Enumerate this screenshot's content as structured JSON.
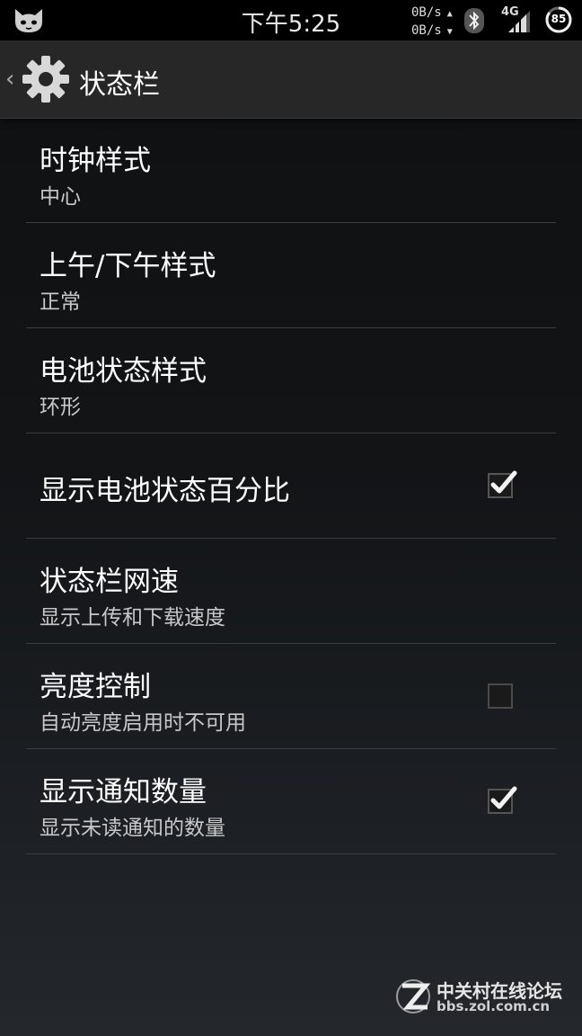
{
  "status_bar": {
    "time": "下午5:25",
    "net_up": "0B/s",
    "net_down": "0B/s",
    "network_type": "4G",
    "battery_level": "85"
  },
  "action_bar": {
    "title": "状态栏",
    "back_glyph": "‹"
  },
  "settings": [
    {
      "title": "时钟样式",
      "summary": "中心"
    },
    {
      "title": "上午/下午样式",
      "summary": "正常"
    },
    {
      "title": "电池状态样式",
      "summary": "环形"
    },
    {
      "title": "显示电池状态百分比",
      "checked": true
    },
    {
      "title": "状态栏网速",
      "summary": "显示上传和下载速度"
    },
    {
      "title": "亮度控制",
      "summary": "自动亮度启用时不可用",
      "checked": false
    },
    {
      "title": "显示通知数量",
      "summary": "显示未读通知的数量",
      "checked": true
    }
  ],
  "watermark": {
    "name": "中关村在线论坛",
    "url": "bbs.zol.com.cn"
  },
  "icons": {
    "cat": "cat-icon",
    "bluetooth": "bluetooth-icon",
    "signal": "signal-icon",
    "battery": "battery-icon",
    "gear": "gear-icon",
    "check": "check-icon"
  }
}
